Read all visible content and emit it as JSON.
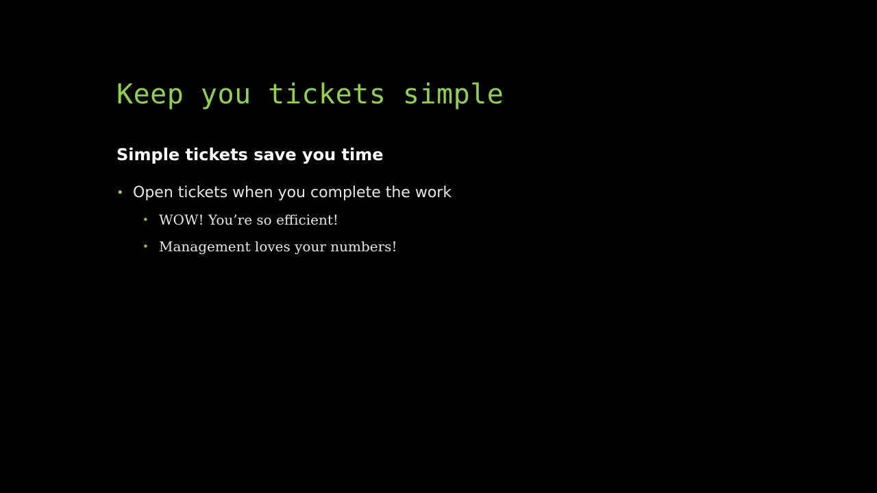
{
  "slide": {
    "title": "Keep you tickets simple",
    "subtitle": "Simple tickets save you time",
    "bullets": [
      {
        "text": "Open tickets when you complete the work",
        "level": 1
      },
      {
        "text": "WOW! You’re so efficient!",
        "level": 2
      },
      {
        "text": "Management loves your numbers!",
        "level": 2
      }
    ],
    "bullet_glyph": "•"
  },
  "colors": {
    "background": "#000000",
    "title": "#92d050",
    "subtitle": "#ffffff",
    "body": "#e6e6e6",
    "bullet": "#92d050"
  }
}
